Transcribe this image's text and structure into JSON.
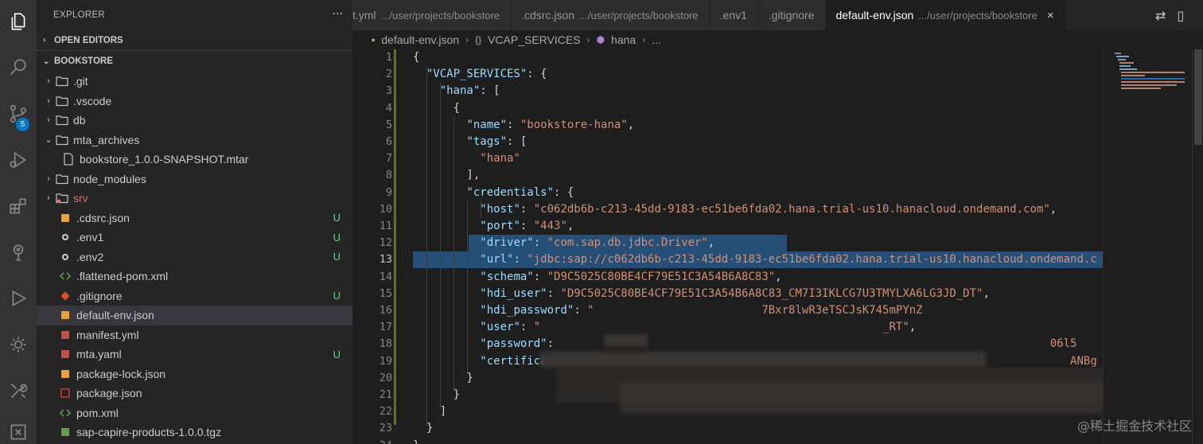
{
  "activity_bar": {
    "items": [
      "explorer-icon",
      "search-icon",
      "source-control-icon",
      "run-debug-icon",
      "extensions-icon",
      "remote-explorer-icon",
      "run-icon",
      "settings-sync-icon",
      "tools-icon",
      "account-icon"
    ],
    "scm_badge": "5"
  },
  "sidebar": {
    "title": "EXPLORER",
    "more": "···",
    "open_editors": "OPEN EDITORS",
    "project": "BOOKSTORE",
    "items": [
      {
        "label": ".git",
        "type": "folder",
        "chev": "›",
        "status": ""
      },
      {
        "label": ".vscode",
        "type": "folder",
        "chev": "›",
        "status": ""
      },
      {
        "label": "db",
        "type": "folder",
        "chev": "›",
        "status": ""
      },
      {
        "label": "mta_archives",
        "type": "folder-open",
        "chev": "⌄",
        "status": ""
      },
      {
        "label": "bookstore_1.0.0-SNAPSHOT.mtar",
        "type": "file",
        "chev": "",
        "status": ""
      },
      {
        "label": "node_modules",
        "type": "folder",
        "chev": "›",
        "status": ""
      },
      {
        "label": "srv",
        "type": "folder-red",
        "chev": "›",
        "status": ""
      },
      {
        "label": ".cdsrc.json",
        "type": "json",
        "chev": "",
        "status": "U"
      },
      {
        "label": ".env1",
        "type": "gear",
        "chev": "",
        "status": "U"
      },
      {
        "label": ".env2",
        "type": "gear",
        "chev": "",
        "status": "U"
      },
      {
        "label": ".flattened-pom.xml",
        "type": "xml",
        "chev": "",
        "status": ""
      },
      {
        "label": ".gitignore",
        "type": "git",
        "chev": "",
        "status": "U"
      },
      {
        "label": "default-env.json",
        "type": "json",
        "chev": "",
        "status": "",
        "selected": true
      },
      {
        "label": "manifest.yml",
        "type": "yml",
        "chev": "",
        "status": ""
      },
      {
        "label": "mta.yaml",
        "type": "yml",
        "chev": "",
        "status": "U"
      },
      {
        "label": "package-lock.json",
        "type": "json",
        "chev": "",
        "status": ""
      },
      {
        "label": "package.json",
        "type": "npm",
        "chev": "",
        "status": ""
      },
      {
        "label": "pom.xml",
        "type": "xml",
        "chev": "",
        "status": ""
      },
      {
        "label": "sap-capire-products-1.0.0.tgz",
        "type": "tgz",
        "chev": "",
        "status": ""
      }
    ]
  },
  "tabs": [
    {
      "label": "t.yml",
      "desc": ".../user/projects/bookstore",
      "active": false
    },
    {
      "label": ".cdsrc.json",
      "desc": ".../user/projects/bookstore",
      "active": false
    },
    {
      "label": ".env1",
      "desc": "",
      "active": false
    },
    {
      "label": ".gitignore",
      "desc": "",
      "active": false
    },
    {
      "label": "default-env.json",
      "desc": ".../user/projects/bookstore",
      "active": true
    }
  ],
  "tab_close": "×",
  "breadcrumb": [
    "default-env.json",
    "VCAP_SERVICES",
    "hana",
    "..."
  ],
  "editor": {
    "line_numbers": [
      "1",
      "2",
      "3",
      "4",
      "5",
      "6",
      "7",
      "8",
      "9",
      "10",
      "11",
      "12",
      "13",
      "14",
      "15",
      "16",
      "17",
      "18",
      "19",
      "20",
      "21",
      "22",
      "23",
      "24"
    ],
    "lines": [
      [
        [
          "p",
          "{"
        ]
      ],
      [
        [
          "p",
          "  "
        ],
        [
          "k",
          "\"VCAP_SERVICES\""
        ],
        [
          "p",
          ": {"
        ]
      ],
      [
        [
          "p",
          "    "
        ],
        [
          "k",
          "\"hana\""
        ],
        [
          "p",
          ": ["
        ]
      ],
      [
        [
          "p",
          "      {"
        ]
      ],
      [
        [
          "p",
          "        "
        ],
        [
          "k",
          "\"name\""
        ],
        [
          "p",
          ": "
        ],
        [
          "s",
          "\"bookstore-hana\""
        ],
        [
          "p",
          ","
        ]
      ],
      [
        [
          "p",
          "        "
        ],
        [
          "k",
          "\"tags\""
        ],
        [
          "p",
          ": ["
        ]
      ],
      [
        [
          "p",
          "          "
        ],
        [
          "s",
          "\"hana\""
        ]
      ],
      [
        [
          "p",
          "        ],"
        ]
      ],
      [
        [
          "p",
          "        "
        ],
        [
          "k",
          "\"credentials\""
        ],
        [
          "p",
          ": {"
        ]
      ],
      [
        [
          "p",
          "          "
        ],
        [
          "k",
          "\"host\""
        ],
        [
          "p",
          ": "
        ],
        [
          "s",
          "\"c062db6b-c213-45dd-9183-ec51be6fda02.hana.trial-us10.hanacloud.ondemand.com\""
        ],
        [
          "p",
          ","
        ]
      ],
      [
        [
          "p",
          "          "
        ],
        [
          "k",
          "\"port\""
        ],
        [
          "p",
          ": "
        ],
        [
          "s",
          "\"443\""
        ],
        [
          "p",
          ","
        ]
      ],
      [
        [
          "p",
          "          "
        ],
        [
          "k",
          "\"driver\""
        ],
        [
          "p",
          ": "
        ],
        [
          "s",
          "\"com.sap.db.jdbc.Driver\""
        ],
        [
          "p",
          ","
        ]
      ],
      [
        [
          "p",
          "          "
        ],
        [
          "k",
          "\"url\""
        ],
        [
          "p",
          ": "
        ],
        [
          "s",
          "\"jdbc:sap://c062db6b-c213-45dd-9183-ec51be6fda02.hana.trial-us10.hanacloud.ondemand.c"
        ]
      ],
      [
        [
          "p",
          "          "
        ],
        [
          "k",
          "\"schema\""
        ],
        [
          "p",
          ": "
        ],
        [
          "s",
          "\"D9C5025C80BE4CF79E51C3A54B6A8C83\""
        ],
        [
          "p",
          ","
        ]
      ],
      [
        [
          "p",
          "          "
        ],
        [
          "k",
          "\"hdi_user\""
        ],
        [
          "p",
          ": "
        ],
        [
          "s",
          "\"D9C5025C80BE4CF79E51C3A54B6A8C83_CM7I3IKLCG7U3TMYLXA6LG3JD_DT\""
        ],
        [
          "p",
          ","
        ]
      ],
      [
        [
          "p",
          "          "
        ],
        [
          "k",
          "\"hdi_password\""
        ],
        [
          "p",
          ": "
        ],
        [
          "s",
          "\"                         7Bxr8lwR3eTSCJsK745mPYnZ"
        ]
      ],
      [
        [
          "p",
          "          "
        ],
        [
          "k",
          "\"user\""
        ],
        [
          "p",
          ": "
        ],
        [
          "s",
          "\"                                                   _RT\""
        ],
        [
          "p",
          ","
        ]
      ],
      [
        [
          "p",
          "          "
        ],
        [
          "k",
          "\"password\""
        ],
        [
          "p",
          ":                                                                          "
        ],
        [
          "s",
          "06l5"
        ]
      ],
      [
        [
          "p",
          "          "
        ],
        [
          "k",
          "\"certificate"
        ],
        [
          "p",
          "                                                                            "
        ],
        [
          "s",
          "ANBg"
        ]
      ],
      [
        [
          "p",
          "        }"
        ]
      ],
      [
        [
          "p",
          "      }"
        ]
      ],
      [
        [
          "p",
          "    ]"
        ]
      ],
      [
        [
          "p",
          "  }"
        ]
      ],
      [
        [
          "p",
          "}"
        ]
      ]
    ]
  },
  "watermark": "@稀土掘金技术社区",
  "colors": {
    "accent": "#007acc",
    "key": "#9cdcfe",
    "string": "#ce9178",
    "selection": "#264f78",
    "untracked": "#73c991"
  }
}
